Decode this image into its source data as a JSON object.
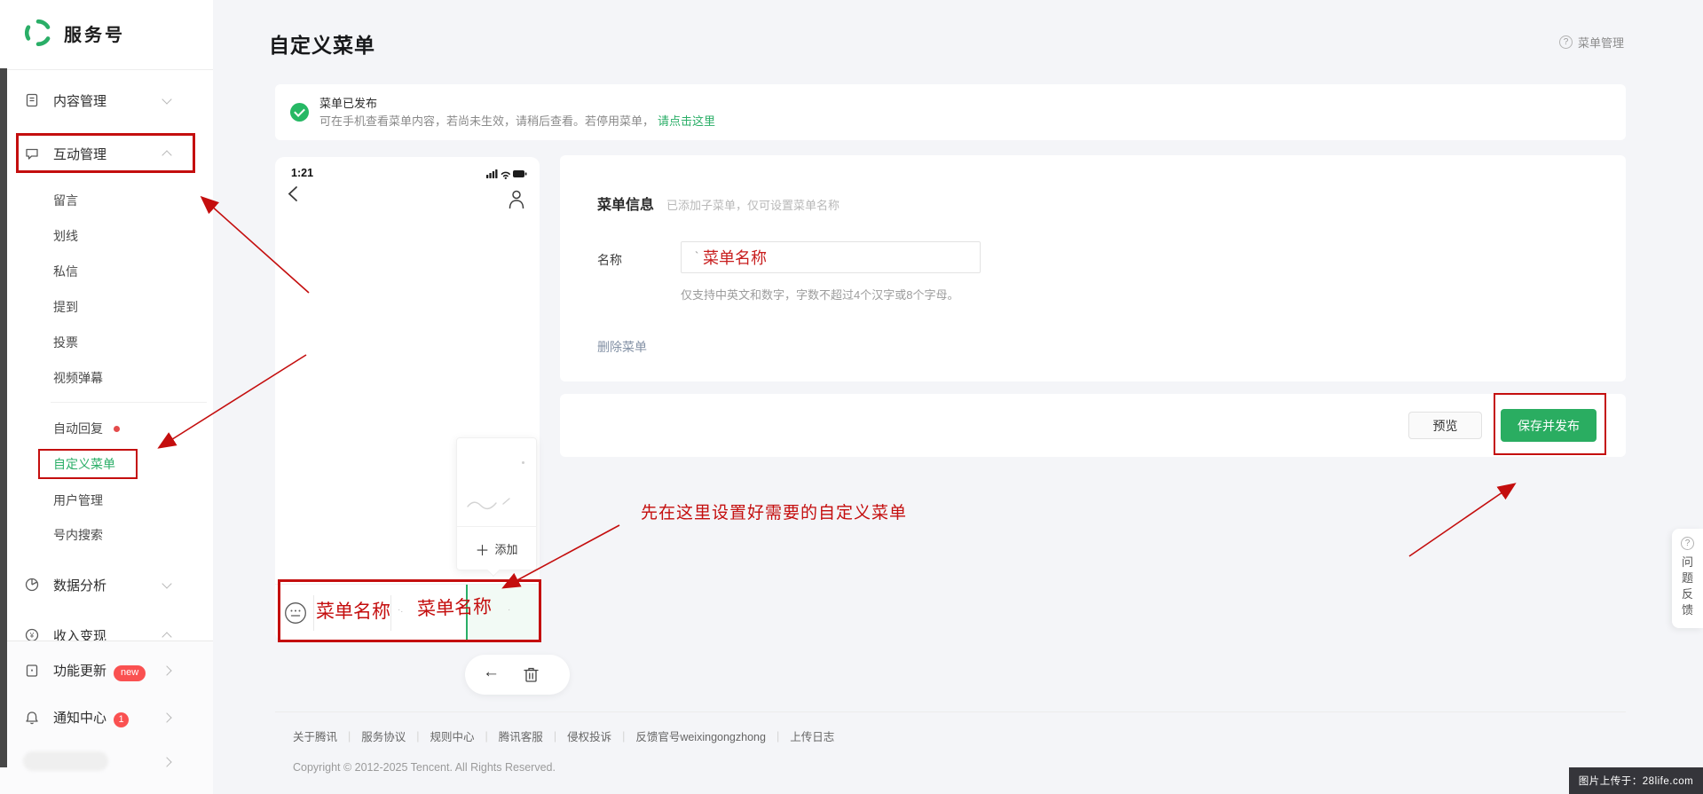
{
  "brand": {
    "name": "服务号"
  },
  "header": {
    "title": "自定义菜单",
    "help": "菜单管理",
    "q_mark": "?"
  },
  "sidebar": {
    "content_mgmt": "内容管理",
    "interact_mgmt": "互动管理",
    "sub": [
      "留言",
      "划线",
      "私信",
      "提到",
      "投票",
      "视频弹幕",
      "自动回复",
      "自定义菜单",
      "用户管理",
      "号内搜索"
    ],
    "data_analysis": "数据分析",
    "monetize": "收入变现",
    "feature_update": "功能更新",
    "feature_badge": "new",
    "notify_center": "通知中心",
    "notify_badge": "1"
  },
  "banner": {
    "title": "菜单已发布",
    "desc": "可在手机查看菜单内容，若尚未生效，请稍后查看。若停用菜单，",
    "link": "请点击这里"
  },
  "phone": {
    "time": "1:21",
    "add_plus": "＋",
    "add_label": "添加",
    "menu_annotation_1": "菜单名称",
    "menu_annotation_2": "菜单名称"
  },
  "form": {
    "section_title": "菜单信息",
    "section_note": "已添加子菜单，仅可设置菜单名称",
    "name_label": "名称",
    "name_value": "菜单名称",
    "hint": "仅支持中英文和数字，字数不超过4个汉字或8个字母。",
    "delete_link": "删除菜单"
  },
  "actions": {
    "preview": "预览",
    "save": "保存并发布"
  },
  "annotation": {
    "tip": "先在这里设置好需要的自定义菜单"
  },
  "feedback": {
    "q_mark": "?",
    "chars": [
      "问",
      "题",
      "反",
      "馈"
    ]
  },
  "footer": {
    "links": [
      "关于腾讯",
      "服务协议",
      "规则中心",
      "腾讯客服",
      "侵权投诉",
      "反馈官号weixingongzhong",
      "上传日志"
    ],
    "separator": "|",
    "copyright": "Copyright © 2012-2025 Tencent. All Rights Reserved."
  },
  "watermark": "图片上传于：28life.com",
  "colors": {
    "green": "#2aae67",
    "annotation_red": "#c40e0e",
    "badge_red": "#fa5151",
    "save_button": "#2aad61"
  }
}
